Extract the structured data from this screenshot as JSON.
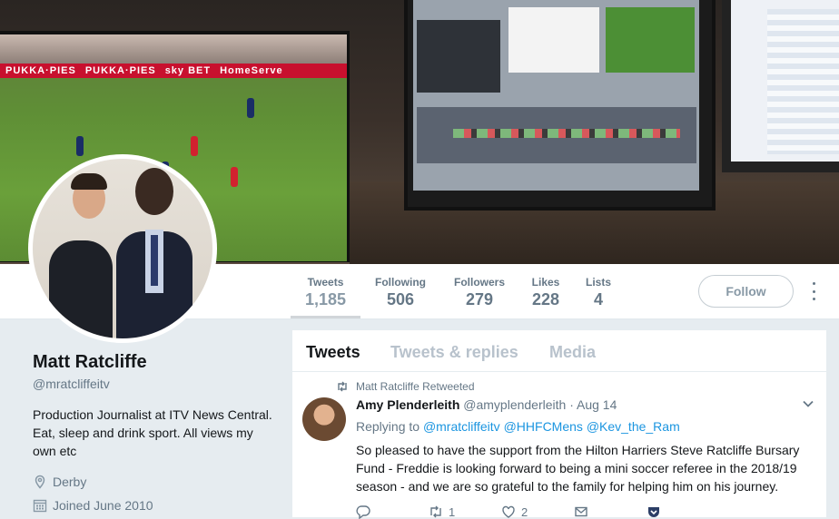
{
  "banner": {
    "ads": [
      "PUKKA·PIES",
      "PUKKA·PIES",
      "sky BET",
      "HomeServe"
    ]
  },
  "profile": {
    "name": "Matt Ratcliffe",
    "handle": "@mratcliffeitv",
    "bio": "Production Journalist at ITV News Central. Eat, sleep and drink sport. All views my own etc",
    "location": "Derby",
    "joined": "Joined June 2010"
  },
  "stats": [
    {
      "label": "Tweets",
      "value": "1,185"
    },
    {
      "label": "Following",
      "value": "506"
    },
    {
      "label": "Followers",
      "value": "279"
    },
    {
      "label": "Likes",
      "value": "228"
    },
    {
      "label": "Lists",
      "value": "4"
    }
  ],
  "follow_label": "Follow",
  "tabs": [
    "Tweets",
    "Tweets & replies",
    "Media"
  ],
  "tweet": {
    "context": "Matt Ratcliffe Retweeted",
    "author_name": "Amy Plenderleith",
    "author_handle": "@amyplenderleith",
    "separator": "·",
    "date": "Aug 14",
    "replying_prefix": "Replying to",
    "mentions": [
      "@mratcliffeitv",
      "@HHFCMens",
      "@Kev_the_Ram"
    ],
    "text": "So pleased to have the support from the Hilton Harriers Steve Ratcliffe Bursary Fund - Freddie is looking forward to being a mini soccer referee in the 2018/19 season - and we are so grateful to the family for helping him on his journey.",
    "actions": {
      "reply": "",
      "retweet": "1",
      "like": "2",
      "dm": ""
    }
  },
  "colors": {
    "link": "#1b95e0",
    "muted": "#657786",
    "text": "#14171a",
    "page_bg": "#e6ecf0",
    "ad_red": "#c8102e"
  }
}
